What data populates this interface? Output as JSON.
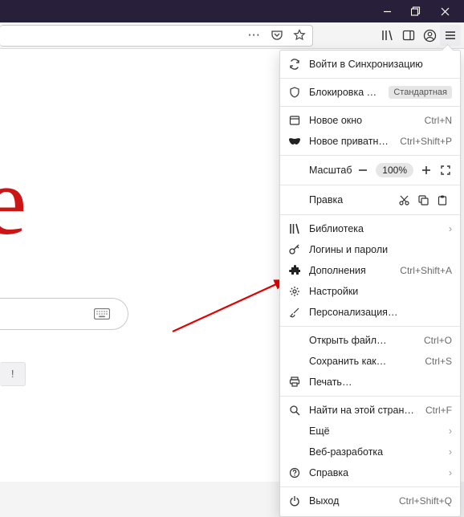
{
  "window": {
    "minimize": "—",
    "restore": "❐",
    "close": "✕"
  },
  "toolbar": {
    "actions_icon": "⋯",
    "pocket_icon": "pocket",
    "star_icon": "star",
    "library_icon": "library",
    "sidebar_icon": "sidebar",
    "account_icon": "account",
    "menu_icon": "menu"
  },
  "page": {
    "logo_fragment": "e",
    "button_fragment": "!"
  },
  "menu": {
    "sync": "Войти в Синхронизацию",
    "content_block": {
      "label": "Блокировка содержимого",
      "tag": "Стандартная"
    },
    "new_window": {
      "label": "Новое окно",
      "shortcut": "Ctrl+N"
    },
    "new_private": {
      "label": "Новое приватное окно",
      "shortcut": "Ctrl+Shift+P"
    },
    "zoom": {
      "label": "Масштаб",
      "percent": "100%"
    },
    "edit": {
      "label": "Правка"
    },
    "library": "Библиотека",
    "logins": "Логины и пароли",
    "addons": {
      "label": "Дополнения",
      "shortcut": "Ctrl+Shift+A"
    },
    "settings": "Настройки",
    "customize": "Персонализация…",
    "open_file": {
      "label": "Открыть файл…",
      "shortcut": "Ctrl+O"
    },
    "save_as": {
      "label": "Сохранить как…",
      "shortcut": "Ctrl+S"
    },
    "print": "Печать…",
    "find": {
      "label": "Найти на этой странице…",
      "shortcut": "Ctrl+F"
    },
    "more": "Ещё",
    "webdev": "Веб-разработка",
    "help": "Справка",
    "exit": {
      "label": "Выход",
      "shortcut": "Ctrl+Shift+Q"
    }
  }
}
